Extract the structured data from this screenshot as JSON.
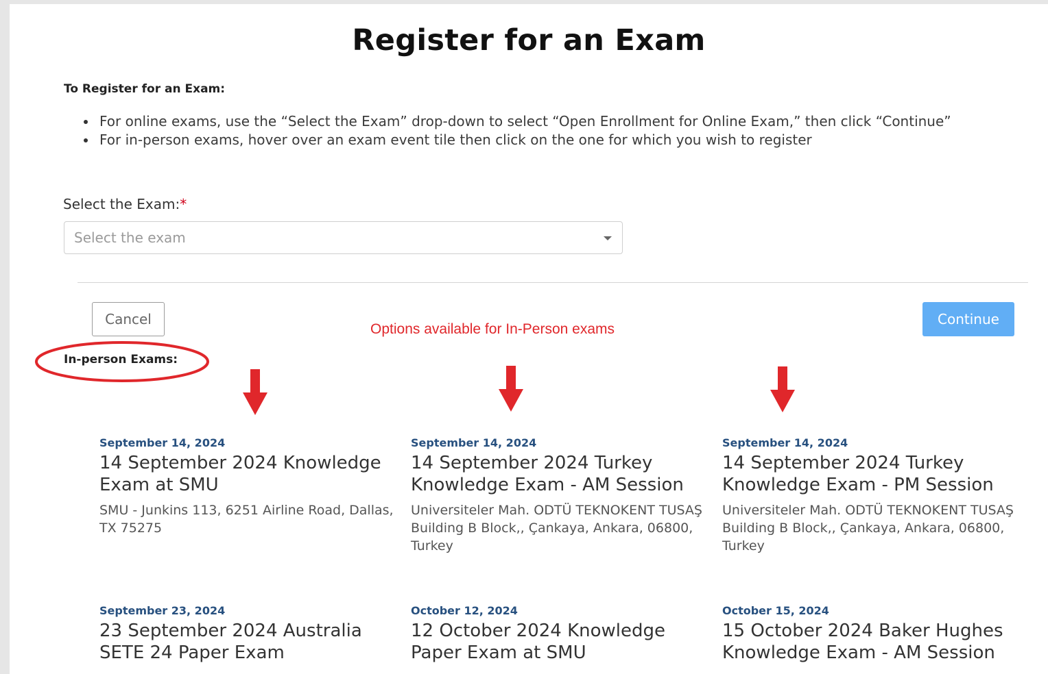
{
  "page": {
    "title": "Register for an Exam",
    "instructions_heading": "To Register for an Exam:",
    "instructions": [
      "For online exams, use the “Select the Exam” drop-down to select “Open Enrollment for Online Exam,” then click “Continue”",
      "For in-person exams, hover over an exam event tile then click on the one for which you wish to register"
    ]
  },
  "form": {
    "select_label": "Select the Exam:",
    "required_marker": "*",
    "select_placeholder": "Select the exam",
    "selected_value": ""
  },
  "buttons": {
    "cancel": "Cancel",
    "continue": "Continue"
  },
  "annotation": {
    "text": "Options available for In-Person exams",
    "color": "#e0272b"
  },
  "in_person": {
    "heading": "In-person Exams:",
    "events": [
      {
        "date": "September 14, 2024",
        "title": "14 September 2024 Knowledge Exam at SMU",
        "address": "SMU - Junkins 113, 6251 Airline Road, Dallas, TX 75275"
      },
      {
        "date": "September 14, 2024",
        "title": "14 September 2024 Turkey Knowledge Exam - AM Session",
        "address": "Universiteler Mah. ODTÜ TEKNOKENT TUSAŞ Building B Block,, Çankaya, Ankara, 06800, Turkey"
      },
      {
        "date": "September 14, 2024",
        "title": "14 September 2024 Turkey Knowledge Exam - PM Session",
        "address": "Universiteler Mah. ODTÜ TEKNOKENT TUSAŞ Building B Block,, Çankaya, Ankara, 06800, Turkey"
      },
      {
        "date": "September 23, 2024",
        "title": "23 September 2024 Australia SETE 24 Paper Exam",
        "address": ""
      },
      {
        "date": "October 12, 2024",
        "title": "12 October 2024 Knowledge Paper Exam at SMU",
        "address": ""
      },
      {
        "date": "October 15, 2024",
        "title": "15 October 2024 Baker Hughes Knowledge Exam - AM Session",
        "address": ""
      }
    ]
  },
  "colors": {
    "primary_button": "#61aef5",
    "date_text": "#27507f",
    "annotation_red": "#e0272b",
    "required_red": "#d0021b"
  },
  "icons": {
    "dropdown": "caret-down-icon",
    "annotation_arrows": "arrow-down-icon",
    "annotation_circle": "oval-highlight"
  }
}
